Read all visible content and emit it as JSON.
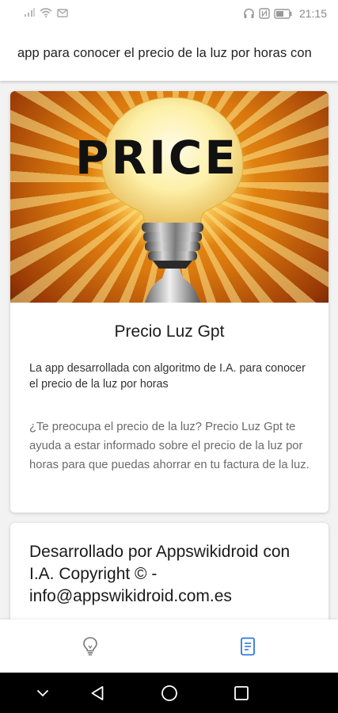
{
  "status_bar": {
    "time": "21:15",
    "icons_left": [
      "signal-icon",
      "wifi-icon",
      "mail-icon"
    ],
    "icons_right": [
      "headphones-icon",
      "nfc-icon",
      "battery-icon"
    ]
  },
  "header": {
    "marquee_text": "app para conocer el precio de la luz por horas con"
  },
  "hero": {
    "word": "PRICE"
  },
  "card": {
    "title": "Precio Luz Gpt",
    "subtitle": "La app desarrollada con algoritmo de I.A. para conocer el precio de la luz por horas",
    "description": "¿Te preocupa el precio de la luz? Precio Luz Gpt te ayuda a estar informado sobre el precio de la luz por horas para que puedas ahorrar en tu factura de la luz."
  },
  "developer": {
    "text": "Desarrollado por Appswikidroid con I.A. Copyright © - info@appswikidroid.com.es"
  },
  "bottom_nav": {
    "items": [
      {
        "icon": "lightbulb-icon",
        "active": false
      },
      {
        "icon": "document-icon",
        "active": true
      }
    ],
    "active_color": "#2e7bd6",
    "inactive_color": "#777777"
  },
  "system_nav": {
    "buttons": [
      "chevron-down-icon",
      "back-icon",
      "home-icon",
      "recents-icon"
    ]
  }
}
